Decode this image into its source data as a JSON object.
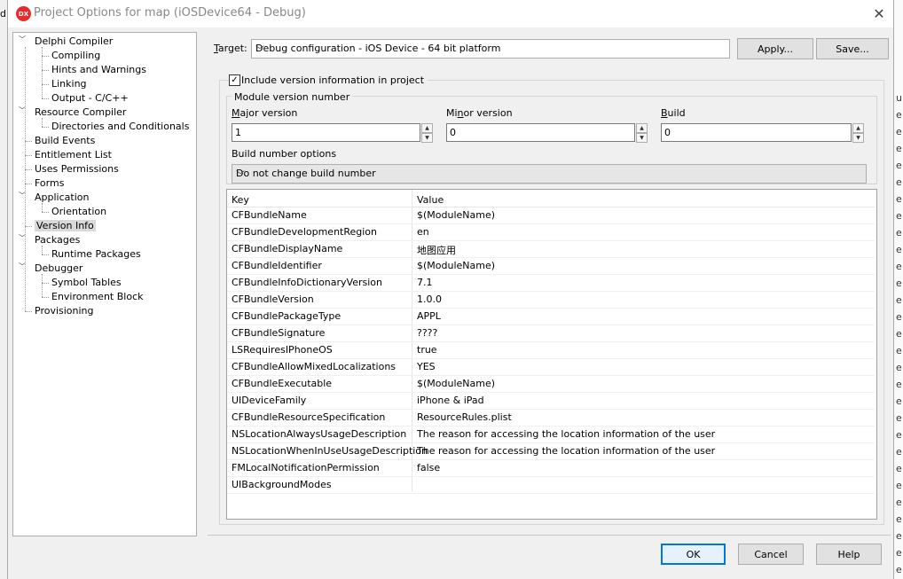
{
  "background": {
    "left_char": "d",
    "right_chars": [
      "u",
      "e",
      "e",
      "e",
      "e",
      "e",
      "e",
      "e",
      "e",
      "e",
      "e",
      "e",
      "e",
      "e",
      "e",
      "e",
      "e",
      "e",
      "e",
      "e",
      "e",
      "e",
      "e",
      "e",
      "e",
      "e",
      "e",
      "e",
      "e"
    ]
  },
  "window": {
    "title": "Project Options for map  (iOSDevice64 - Debug)",
    "icon_label": "DX"
  },
  "tree": [
    {
      "label": "Delphi Compiler",
      "level": 0,
      "expanded": true
    },
    {
      "label": "Compiling",
      "level": 1
    },
    {
      "label": "Hints and Warnings",
      "level": 1
    },
    {
      "label": "Linking",
      "level": 1
    },
    {
      "label": "Output - C/C++",
      "level": 1
    },
    {
      "label": "Resource Compiler",
      "level": 0,
      "expanded": true
    },
    {
      "label": "Directories and Conditionals",
      "level": 1
    },
    {
      "label": "Build Events",
      "level": 0
    },
    {
      "label": "Entitlement List",
      "level": 0
    },
    {
      "label": "Uses Permissions",
      "level": 0
    },
    {
      "label": "Forms",
      "level": 0
    },
    {
      "label": "Application",
      "level": 0,
      "expanded": true
    },
    {
      "label": "Orientation",
      "level": 1
    },
    {
      "label": "Version Info",
      "level": 0,
      "selected": true
    },
    {
      "label": "Packages",
      "level": 0,
      "expanded": true
    },
    {
      "label": "Runtime Packages",
      "level": 1
    },
    {
      "label": "Debugger",
      "level": 0,
      "expanded": true
    },
    {
      "label": "Symbol Tables",
      "level": 1
    },
    {
      "label": "Environment Block",
      "level": 1
    },
    {
      "label": "Provisioning",
      "level": 0
    }
  ],
  "target": {
    "label_prefix": "",
    "label_underlined": "T",
    "label_suffix": "arget:",
    "value": "Debug configuration - iOS Device - 64 bit platform",
    "apply_label": "Apply...",
    "save_label": "Save..."
  },
  "version": {
    "include_label": "Include version information in project",
    "include_checked": true,
    "module_group_label": "Module version number",
    "major": {
      "label_pre": "",
      "label_ul": "M",
      "label_post": "ajor version",
      "value": "1"
    },
    "minor": {
      "label_pre": "Mi",
      "label_ul": "n",
      "label_post": "or version",
      "value": "0"
    },
    "build": {
      "label_pre": "",
      "label_ul": "B",
      "label_post": "uild",
      "value": "0"
    },
    "build_options_label": "Build number options",
    "build_options_value": "Do not change build number"
  },
  "grid": {
    "headers": {
      "key": "Key",
      "value": "Value"
    },
    "rows": [
      {
        "key": "CFBundleName",
        "value": "$(ModuleName)"
      },
      {
        "key": "CFBundleDevelopmentRegion",
        "value": "en"
      },
      {
        "key": "CFBundleDisplayName",
        "value": "地图应用"
      },
      {
        "key": "CFBundleIdentifier",
        "value": "$(ModuleName)"
      },
      {
        "key": "CFBundleInfoDictionaryVersion",
        "value": "7.1"
      },
      {
        "key": "CFBundleVersion",
        "value": "1.0.0"
      },
      {
        "key": "CFBundlePackageType",
        "value": "APPL"
      },
      {
        "key": "CFBundleSignature",
        "value": "????"
      },
      {
        "key": "LSRequiresIPhoneOS",
        "value": "true"
      },
      {
        "key": "CFBundleAllowMixedLocalizations",
        "value": "YES"
      },
      {
        "key": "CFBundleExecutable",
        "value": "$(ModuleName)"
      },
      {
        "key": "UIDeviceFamily",
        "value": "iPhone & iPad"
      },
      {
        "key": "CFBundleResourceSpecification",
        "value": "ResourceRules.plist"
      },
      {
        "key": "NSLocationAlwaysUsageDescription",
        "value": "The reason for accessing the location information of the user"
      },
      {
        "key": "NSLocationWhenInUseUsageDescription",
        "value": "The reason for accessing the location information of the user"
      },
      {
        "key": "FMLocalNotificationPermission",
        "value": "false"
      },
      {
        "key": "UIBackgroundModes",
        "value": ""
      }
    ]
  },
  "footer": {
    "ok": "OK",
    "cancel": "Cancel",
    "help": "Help"
  }
}
